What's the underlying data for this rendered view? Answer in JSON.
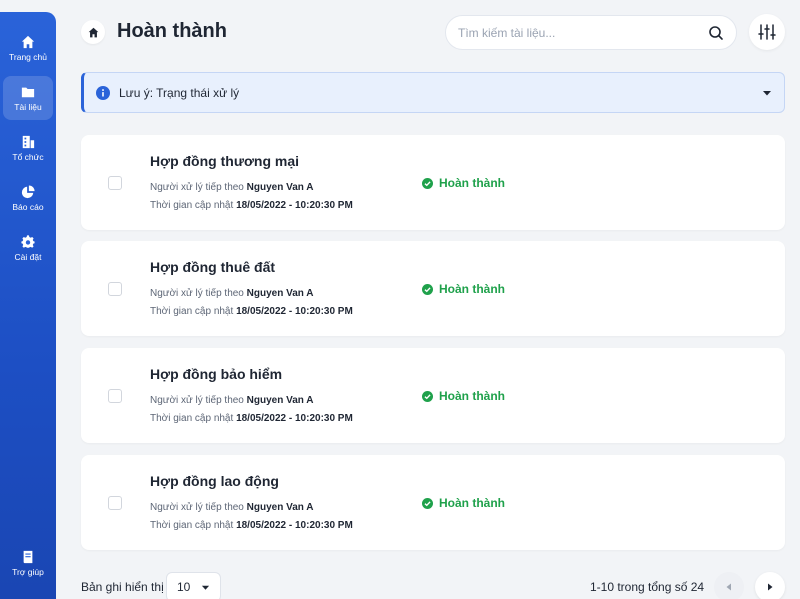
{
  "sidebar": {
    "items": [
      {
        "label": "Trang chủ",
        "icon": "home-icon"
      },
      {
        "label": "Tài liệu",
        "icon": "folder-icon"
      },
      {
        "label": "Tổ chức",
        "icon": "building-icon"
      },
      {
        "label": "Báo cáo",
        "icon": "pie-chart-icon"
      },
      {
        "label": "Cài đặt",
        "icon": "gear-icon"
      }
    ],
    "help": {
      "label": "Trợ giúp",
      "icon": "book-icon"
    }
  },
  "header": {
    "title": "Hoàn thành",
    "search_placeholder": "Tìm kiếm tài liệu..."
  },
  "notice": {
    "text": "Lưu ý: Trạng thái xử lý"
  },
  "documents": [
    {
      "title": "Hợp đồng thương mại",
      "handler_label": "Người xử lý tiếp theo",
      "handler": "Nguyen Van A",
      "updated_label": "Thời gian cập nhật",
      "updated": "18/05/2022 - 10:20:30 PM",
      "status": "Hoàn thành"
    },
    {
      "title": "Hợp đồng thuê đất",
      "handler_label": "Người xử lý tiếp theo",
      "handler": "Nguyen Van A",
      "updated_label": "Thời gian cập nhật",
      "updated": "18/05/2022 - 10:20:30 PM",
      "status": "Hoàn thành"
    },
    {
      "title": "Hợp đồng bảo hiểm",
      "handler_label": "Người xử lý tiếp theo",
      "handler": "Nguyen Van A",
      "updated_label": "Thời gian cập nhật",
      "updated": "18/05/2022 - 10:20:30 PM",
      "status": "Hoàn thành"
    },
    {
      "title": "Hợp đồng lao động",
      "handler_label": "Người xử lý tiếp theo",
      "handler": "Nguyen Van A",
      "updated_label": "Thời gian cập nhật",
      "updated": "18/05/2022 - 10:20:30 PM",
      "status": "Hoàn thành"
    }
  ],
  "footer": {
    "page_size_label": "Bản ghi hiển thị",
    "page_size": "10",
    "range": "1-10 trong tổng số 24"
  },
  "colors": {
    "sidebar": "#2a63d9",
    "status_green": "#1fa14b",
    "notice_bg": "#e8f0fd"
  }
}
